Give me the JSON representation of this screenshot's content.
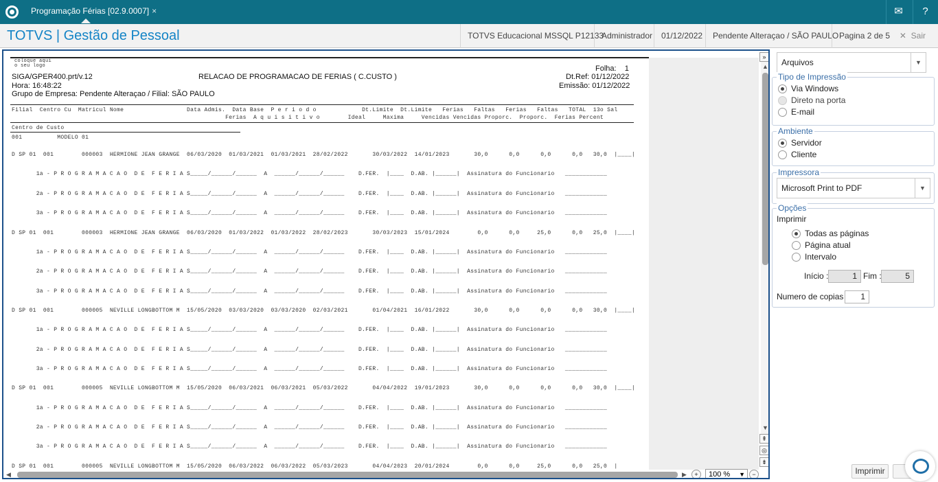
{
  "tab": {
    "title": "Programação Férias [02.9.0007]",
    "close": "×"
  },
  "header": {
    "brand": "TOTVS | Gestão de Pessoal",
    "system": "TOTVS Educacional MSSQL P12133",
    "user": "Administrador",
    "date": "01/12/2022",
    "company": "Pendente Alteraçao / SÃO PAULO",
    "page": "Pagina 2 de 5",
    "exit": "Sair"
  },
  "report": {
    "logo": "coloque aqui o seu logo",
    "program": "SIGA/GPER400.prt/v.12",
    "title": "RELACAO DE PROGRAMACAO DE FERIAS ( C.CUSTO )",
    "hora": "Hora: 16:48:22",
    "grupo": "Grupo de Empresa: Pendente Alteraçao / Filial: SÃO PAULO",
    "folha": "Folha:    1",
    "dtref": "Dt.Ref: 01/12/2022",
    "emissao": "Emissão: 01/12/2022",
    "col_header_1": "Filial  Centro Cu  Matricul Nome                  Data Admis.  Data Base  P e r i o d o             Dt.Limite  Dt.Limite   Ferias   Faltas   Ferias   Faltas   TOTAL  13o Sal",
    "col_header_2": "                                                             Ferias  A q u i s i t i v o        Ideal     Maxima     Vencidas Vencidas Proporc.  Proporc.  Ferias Percent",
    "cc_label": "Centro de Custo",
    "cc_row": "001          MODELO 01",
    "lines": [
      "D SP 01  001        000003  HERMIONE JEAN GRANGE  06/03/2020  01/03/2021  01/03/2021  28/02/2022       30/03/2022  14/01/2023       30,0      0,0      0,0      0,0   30,0  |____|",
      "       1a - P R O G R A M A C A O  D E  F E R I A S_____/______/______  A  ______/______/______    D.FER.  |____  D.AB. |______|  Assinatura do Funcionario   ____________",
      "       2a - P R O G R A M A C A O  D E  F E R I A S_____/______/______  A  ______/______/______    D.FER.  |____  D.AB. |______|  Assinatura do Funcionario   ____________",
      "       3a - P R O G R A M A C A O  D E  F E R I A S_____/______/______  A  ______/______/______    D.FER.  |____  D.AB. |______|  Assinatura do Funcionario   ____________",
      "D SP 01  001        000003  HERMIONE JEAN GRANGE  06/03/2020  01/03/2022  01/03/2022  28/02/2023       30/03/2023  15/01/2024        0,0      0,0     25,0      0,0   25,0  |____|",
      "       1a - P R O G R A M A C A O  D E  F E R I A S_____/______/______  A  ______/______/______    D.FER.  |____  D.AB. |______|  Assinatura do Funcionario   ____________",
      "       2a - P R O G R A M A C A O  D E  F E R I A S_____/______/______  A  ______/______/______    D.FER.  |____  D.AB. |______|  Assinatura do Funcionario   ____________",
      "       3a - P R O G R A M A C A O  D E  F E R I A S_____/______/______  A  ______/______/______    D.FER.  |____  D.AB. |______|  Assinatura do Funcionario   ____________",
      "D SP 01  001        000005  NEVILLE LONGBOTTOM M  15/05/2020  03/03/2020  03/03/2020  02/03/2021       01/04/2021  16/01/2022       30,0      0,0      0,0      0,0   30,0  |____|",
      "       1a - P R O G R A M A C A O  D E  F E R I A S_____/______/______  A  ______/______/______    D.FER.  |____  D.AB. |______|  Assinatura do Funcionario   ____________",
      "       2a - P R O G R A M A C A O  D E  F E R I A S_____/______/______  A  ______/______/______    D.FER.  |____  D.AB. |______|  Assinatura do Funcionario   ____________",
      "       3a - P R O G R A M A C A O  D E  F E R I A S_____/______/______  A  ______/______/______    D.FER.  |____  D.AB. |______|  Assinatura do Funcionario   ____________",
      "D SP 01  001        000005  NEVILLE LONGBOTTOM M  15/05/2020  06/03/2021  06/03/2021  05/03/2022       04/04/2022  19/01/2023       30,0      0,0      0,0      0,0   30,0  |____|",
      "       1a - P R O G R A M A C A O  D E  F E R I A S_____/______/______  A  ______/______/______    D.FER.  |____  D.AB. |______|  Assinatura do Funcionario   ____________",
      "       2a - P R O G R A M A C A O  D E  F E R I A S_____/______/______  A  ______/______/______    D.FER.  |____  D.AB. |______|  Assinatura do Funcionario   ____________",
      "       3a - P R O G R A M A C A O  D E  F E R I A S_____/______/______  A  ______/______/______    D.FER.  |____  D.AB. |______|  Assinatura do Funcionario   ____________",
      "D SP 01  001        000005  NEVILLE LONGBOTTOM M  15/05/2020  06/03/2022  06/03/2022  05/03/2023       04/04/2023  20/01/2024        0,0      0,0     25,0      0,0   25,0  |"
    ]
  },
  "zoom": "100 %",
  "panel": {
    "output_select": "Arquivos",
    "print_type": {
      "title": "Tipo de Impressão",
      "options": [
        "Via Windows",
        "Direto na porta",
        "E-mail"
      ]
    },
    "env": {
      "title": "Ambiente",
      "options": [
        "Servidor",
        "Cliente"
      ]
    },
    "printer": {
      "title": "Impressora",
      "value": "Microsoft Print to PDF"
    },
    "opts": {
      "title": "Opções",
      "print_label": "Imprimir",
      "pages": [
        "Todas as páginas",
        "Página atual",
        "Intervalo"
      ],
      "start_label": "Início :",
      "start": "1",
      "end_label": "Fim :",
      "end": "5",
      "copies_label": "Numero de copias",
      "copies": "1"
    },
    "print_button": "Imprimir"
  }
}
